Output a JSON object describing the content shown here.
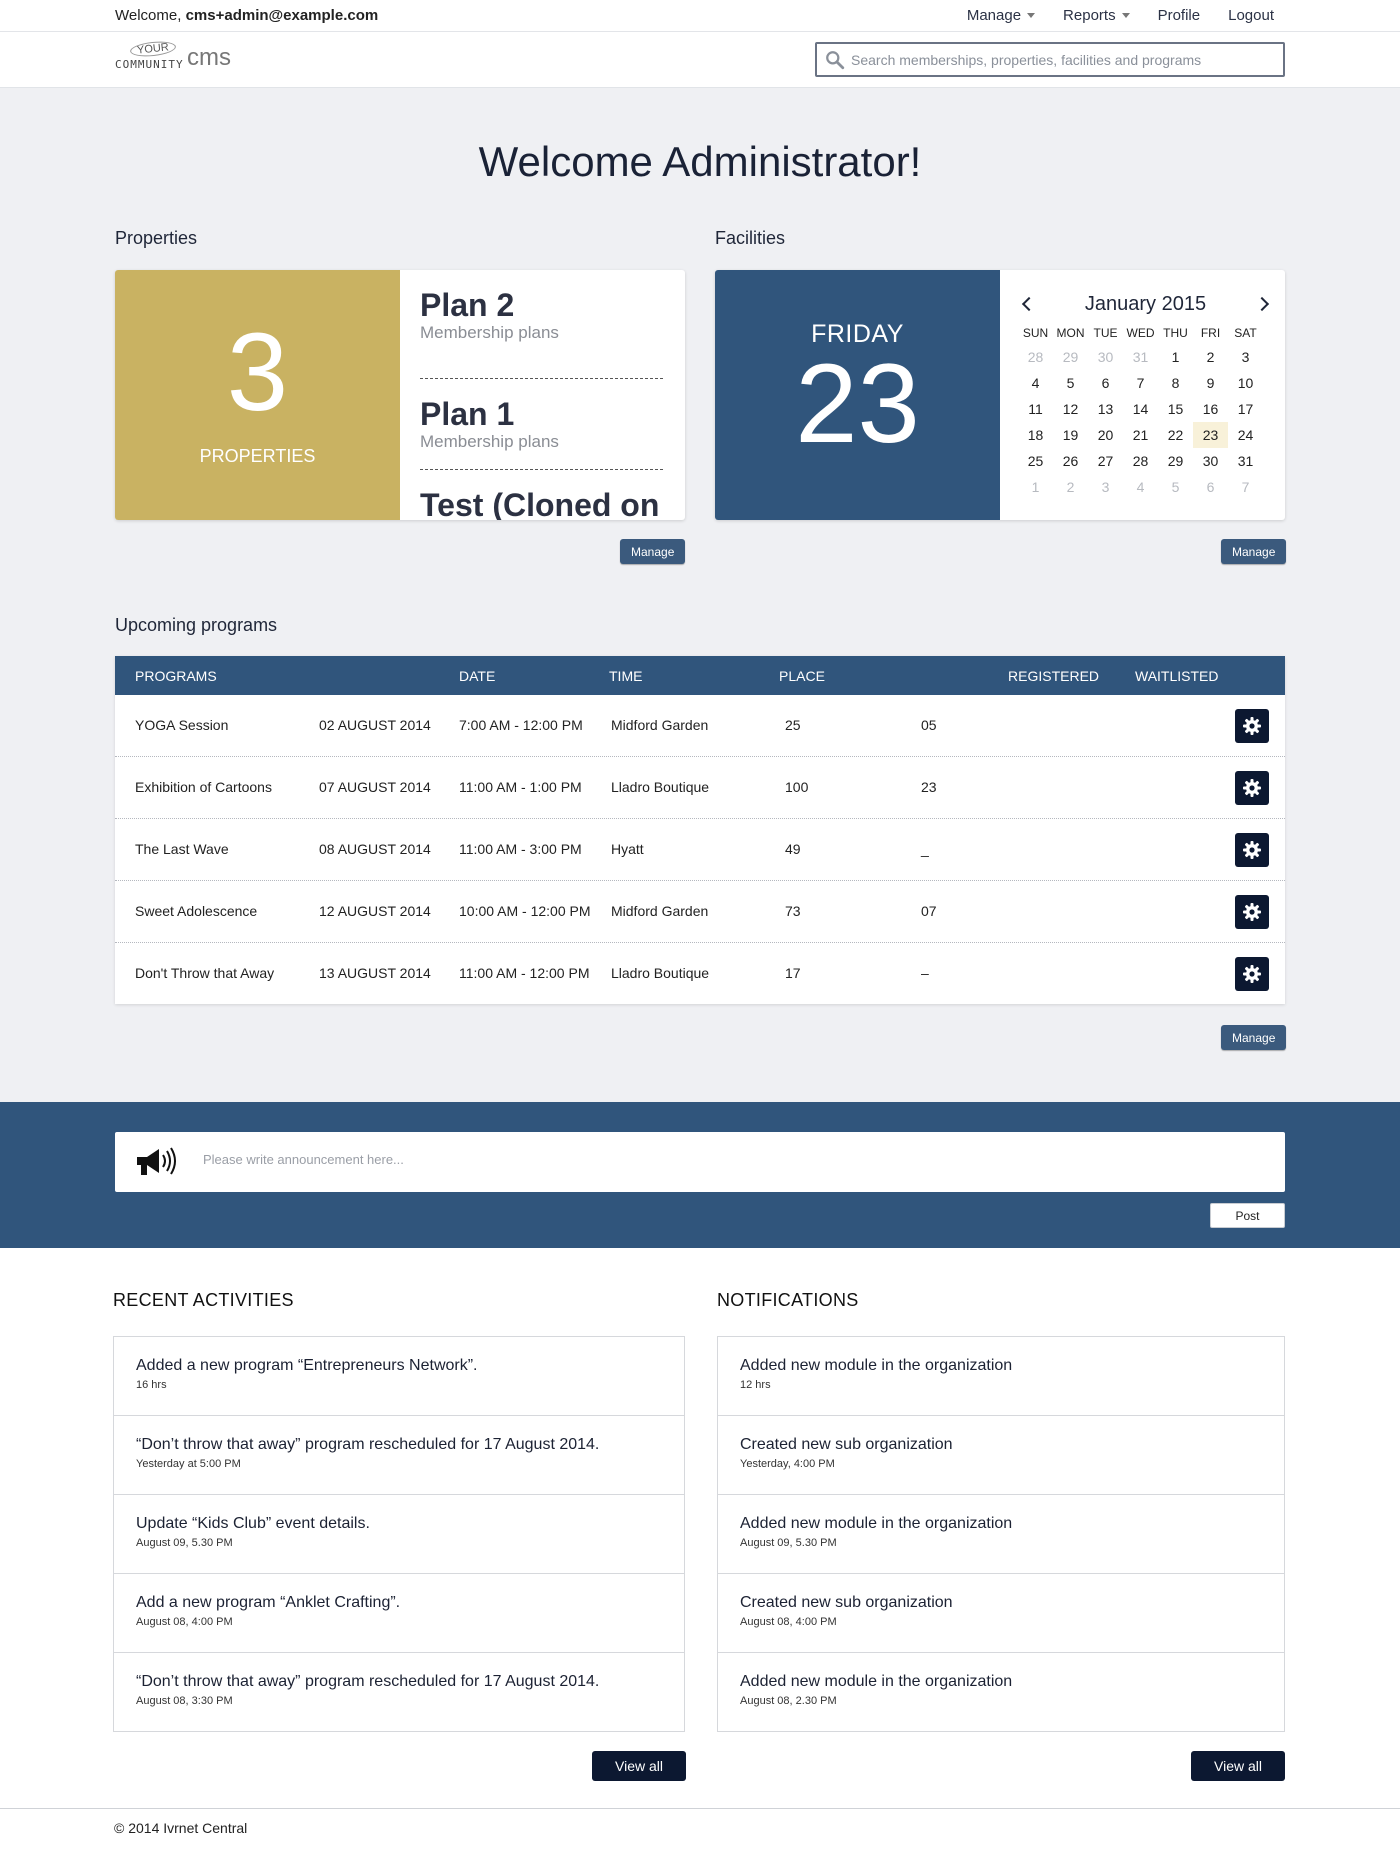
{
  "topbar": {
    "welcome_prefix": "Welcome, ",
    "user_email": "cms+admin@example.com",
    "nav": [
      "Manage",
      "Reports",
      "Profile",
      "Logout"
    ]
  },
  "brand": {
    "logo_your": "YOUR",
    "logo_community": "COMMUNITY",
    "logo_cms": "cms",
    "search_placeholder": "Search memberships, properties, facilities and programs"
  },
  "page_title": "Welcome Administrator!",
  "properties": {
    "label": "Properties",
    "count": "3",
    "count_label": "PROPERTIES",
    "plans": [
      {
        "name": "Plan 2",
        "sub": "Membership plans"
      },
      {
        "name": "Plan 1",
        "sub": "Membership plans"
      },
      {
        "name": "Test (Cloned on",
        "sub": ""
      }
    ],
    "manage_label": "Manage"
  },
  "facilities": {
    "label": "Facilities",
    "day_name": "FRIDAY",
    "day_number": "23",
    "month": "January 2015",
    "weekdays": [
      "SUN",
      "MON",
      "TUE",
      "WED",
      "THU",
      "FRI",
      "SAT"
    ],
    "weeks": [
      [
        "28",
        "29",
        "30",
        "31",
        "1",
        "2",
        "3"
      ],
      [
        "4",
        "5",
        "6",
        "7",
        "8",
        "9",
        "10"
      ],
      [
        "11",
        "12",
        "13",
        "14",
        "15",
        "16",
        "17"
      ],
      [
        "18",
        "19",
        "20",
        "21",
        "22",
        "23",
        "24"
      ],
      [
        "25",
        "26",
        "27",
        "28",
        "29",
        "30",
        "31"
      ],
      [
        "1",
        "2",
        "3",
        "4",
        "5",
        "6",
        "7"
      ]
    ],
    "manage_label": "Manage"
  },
  "programs": {
    "label": "Upcoming programs",
    "headers": [
      "PROGRAMS",
      "DATE",
      "TIME",
      "PLACE",
      "REGISTERED",
      "WAITLISTED"
    ],
    "rows": [
      {
        "name": "YOGA Session",
        "date": "02 AUGUST 2014",
        "time": "7:00 AM - 12:00 PM",
        "place": "Midford Garden",
        "registered": "25",
        "waitlisted": "05"
      },
      {
        "name": "Exhibition of Cartoons",
        "date": "07 AUGUST 2014",
        "time": "11:00 AM - 1:00 PM",
        "place": "Lladro Boutique",
        "registered": "100",
        "waitlisted": "23"
      },
      {
        "name": "The Last Wave",
        "date": "08 AUGUST 2014",
        "time": "11:00 AM - 3:00 PM",
        "place": "Hyatt",
        "registered": "49",
        "waitlisted": "_"
      },
      {
        "name": "Sweet Adolescence",
        "date": "12 AUGUST 2014",
        "time": "10:00 AM - 12:00 PM",
        "place": "Midford Garden",
        "registered": "73",
        "waitlisted": "07"
      },
      {
        "name": "Don't Throw that Away",
        "date": "13 AUGUST 2014",
        "time": "11:00 AM - 12:00 PM",
        "place": "Lladro Boutique",
        "registered": "17",
        "waitlisted": "–"
      }
    ],
    "manage_label": "Manage"
  },
  "announcement": {
    "placeholder": "Please write announcement here...",
    "post_label": "Post"
  },
  "recent_activities": {
    "title": "RECENT ACTIVITIES",
    "items": [
      {
        "text": "Added a new program “Entrepreneurs Network”.",
        "time": "16 hrs"
      },
      {
        "text": "“Don’t throw that away” program rescheduled  for 17 August 2014.",
        "time": "Yesterday at 5:00 PM"
      },
      {
        "text": "Update “Kids Club” event details.",
        "time": "August 09, 5.30 PM"
      },
      {
        "text": "Add a new program “Anklet Crafting”.",
        "time": "August 08, 4:00 PM"
      },
      {
        "text": "“Don’t throw that away” program rescheduled  for 17 August 2014.",
        "time": "August 08, 3:30 PM"
      }
    ],
    "view_all": "View all"
  },
  "notifications": {
    "title": "NOTIFICATIONS",
    "items": [
      {
        "text": "Added new module in the organization",
        "time": "12 hrs"
      },
      {
        "text": "Created new sub organization",
        "time": "Yesterday, 4:00 PM"
      },
      {
        "text": "Added new module in the organization",
        "time": "August 09, 5.30 PM"
      },
      {
        "text": "Created new sub organization",
        "time": "August 08, 4:00 PM"
      },
      {
        "text": "Added new module in the organization",
        "time": "August 08, 2.30 PM"
      }
    ],
    "view_all": "View all"
  },
  "footer": {
    "copyright": "© 2014 Ivrnet Central"
  },
  "colors": {
    "primary_blue": "#30557c",
    "gold": "#c9b262",
    "navy_button": "#0c1831",
    "page_bg": "#eff0f3"
  }
}
